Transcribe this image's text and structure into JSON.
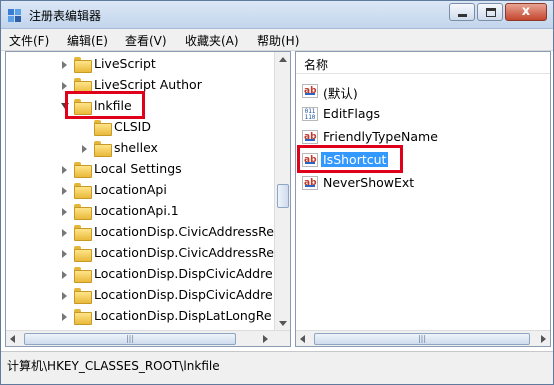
{
  "window": {
    "title": "注册表编辑器",
    "buttons": {
      "minimize": "minimize",
      "maximize": "maximize",
      "close": "x"
    }
  },
  "menu": [
    {
      "label": "文件(F)"
    },
    {
      "label": "编辑(E)"
    },
    {
      "label": "查看(V)"
    },
    {
      "label": "收藏夹(A)"
    },
    {
      "label": "帮助(H)"
    }
  ],
  "tree": {
    "items": [
      {
        "label": "LiveScript",
        "expander": "collapsed"
      },
      {
        "label": "LiveScript Author",
        "expander": "collapsed"
      },
      {
        "label": "lnkfile",
        "expander": "expanded",
        "highlighted": true
      },
      {
        "label": "CLSID",
        "expander": "none"
      },
      {
        "label": "shellex",
        "expander": "collapsed"
      },
      {
        "label": "Local Settings",
        "expander": "collapsed"
      },
      {
        "label": "LocationApi",
        "expander": "collapsed"
      },
      {
        "label": "LocationApi.1",
        "expander": "collapsed"
      },
      {
        "label": "LocationDisp.CivicAddressRe",
        "expander": "collapsed"
      },
      {
        "label": "LocationDisp.CivicAddressRe",
        "expander": "collapsed"
      },
      {
        "label": "LocationDisp.DispCivicAddre",
        "expander": "collapsed"
      },
      {
        "label": "LocationDisp.DispCivicAddre",
        "expander": "collapsed"
      },
      {
        "label": "LocationDisp.DispLatLongRe",
        "expander": "collapsed"
      }
    ]
  },
  "values_pane": {
    "column_header": "名称",
    "items": [
      {
        "label": "(默认)",
        "icon": "string-value-icon"
      },
      {
        "label": "EditFlags",
        "icon": "binary-value-icon"
      },
      {
        "label": "FriendlyTypeName",
        "icon": "string-value-icon"
      },
      {
        "label": "IsShortcut",
        "icon": "string-value-icon",
        "selected": true,
        "highlighted": true
      },
      {
        "label": "NeverShowExt",
        "icon": "string-value-icon"
      }
    ]
  },
  "status_bar": {
    "path": "计算机\\HKEY_CLASSES_ROOT\\lnkfile"
  },
  "colors": {
    "selection": "#3399ff",
    "highlight_box": "#e0001a",
    "folder": "#f4cc55"
  }
}
